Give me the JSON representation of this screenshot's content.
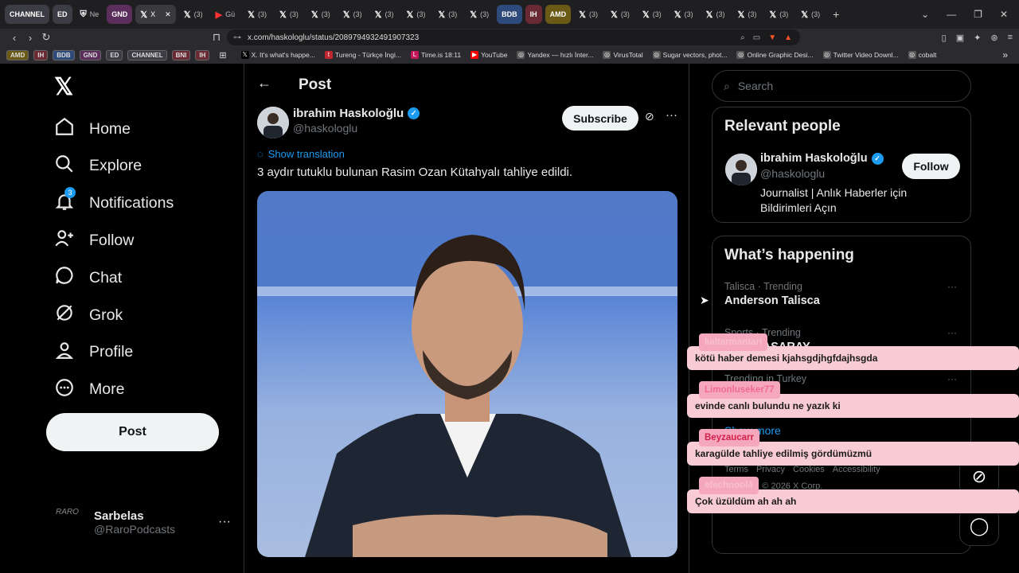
{
  "browser": {
    "tabs": [
      {
        "label": "CHANNEL",
        "group": true,
        "color": "#3c3c44"
      },
      {
        "label": "ED",
        "group": true,
        "color": "#3c3c44"
      },
      {
        "label": "Ne",
        "icon": "shield-icon"
      },
      {
        "label": "GND",
        "group": true,
        "color": "#5b2e5b"
      },
      {
        "label": "X",
        "icon": "x-icon",
        "active": true
      },
      {
        "label": "(3)",
        "icon": "x-icon"
      },
      {
        "label": "Gü",
        "icon": "yt-icon"
      },
      {
        "label": "(3)",
        "icon": "x-icon"
      },
      {
        "label": "(3)",
        "icon": "x-icon"
      },
      {
        "label": "(3)",
        "icon": "x-icon"
      },
      {
        "label": "(3)",
        "icon": "x-icon"
      },
      {
        "label": "(3)",
        "icon": "x-icon"
      },
      {
        "label": "(3)",
        "icon": "x-icon"
      },
      {
        "label": "(3)",
        "icon": "x-icon"
      },
      {
        "label": "(3)",
        "icon": "x-icon"
      },
      {
        "label": "BDB",
        "group": true,
        "color": "#2e4a7a"
      },
      {
        "label": "IH",
        "group": true,
        "color": "#6a2a33"
      },
      {
        "label": "AMD",
        "group": true,
        "color": "#6a5a16"
      },
      {
        "label": "(3)",
        "icon": "x-icon"
      },
      {
        "label": "(3)",
        "icon": "x-icon"
      },
      {
        "label": "(3)",
        "icon": "x-icon"
      },
      {
        "label": "(3)",
        "icon": "x-icon"
      },
      {
        "label": "(3)",
        "icon": "x-icon"
      },
      {
        "label": "(3)",
        "icon": "x-icon"
      },
      {
        "label": "(3)",
        "icon": "x-icon"
      },
      {
        "label": "(3)",
        "icon": "x-icon"
      }
    ],
    "url": "x.com/haskologlu/status/2089794932491907323",
    "bookmarks_groups": [
      "AMD",
      "IH",
      "BDB",
      "GND",
      "ED",
      "CHANNEL",
      "BNI",
      "IH"
    ],
    "bookmarks": [
      {
        "label": "X. It's what's happe...",
        "icon": "x-icon"
      },
      {
        "label": "Tureng - Türkçe İngi...",
        "icon": "t-icon"
      },
      {
        "label": "Time.is 18:11",
        "icon": "clock-icon"
      },
      {
        "label": "YouTube",
        "icon": "youtube-icon"
      },
      {
        "label": "Yandex — hızlı İnter...",
        "icon": "globe-icon"
      },
      {
        "label": "VirusTotal",
        "icon": "globe-icon"
      },
      {
        "label": "Sugar vectors, phot...",
        "icon": "globe-icon"
      },
      {
        "label": "Online Graphic Desi...",
        "icon": "globe-icon"
      },
      {
        "label": "Twitter Video Downl...",
        "icon": "globe-icon"
      },
      {
        "label": "cobalt",
        "icon": "globe-icon"
      }
    ]
  },
  "sidebar": {
    "items": [
      {
        "label": "Home",
        "icon": "home-icon"
      },
      {
        "label": "Explore",
        "icon": "search-icon"
      },
      {
        "label": "Notifications",
        "icon": "bell-icon",
        "badge": "3"
      },
      {
        "label": "Follow",
        "icon": "add-user-icon"
      },
      {
        "label": "Chat",
        "icon": "chat-icon"
      },
      {
        "label": "Grok",
        "icon": "grok-icon"
      },
      {
        "label": "Profile",
        "icon": "profile-icon"
      },
      {
        "label": "More",
        "icon": "more-circle-icon"
      }
    ],
    "post_label": "Post",
    "account": {
      "name": "Sarbelas",
      "handle": "@RaroPodcasts",
      "avatar_text": "RARO"
    }
  },
  "main": {
    "header_title": "Post",
    "author": {
      "name": "ibrahim Haskoloğlu",
      "handle": "@haskologlu"
    },
    "subscribe_label": "Subscribe",
    "show_translation": "Show translation",
    "text": "3 aydır tutuklu bulunan Rasim Ozan Kütahyalı tahliye edildi."
  },
  "aside": {
    "search_placeholder": "Search",
    "relevant_title": "Relevant people",
    "person": {
      "name": "ibrahim Haskoloğlu",
      "handle": "@haskologlu",
      "bio": "Journalist | Anlık Haberler için Bildirimleri Açın"
    },
    "follow_label": "Follow",
    "happening_title": "What’s happening",
    "trends": [
      {
        "context": "Talisca · Trending",
        "title": "Anderson Talisca"
      },
      {
        "context": "Sports · Trending",
        "title": "GALATASARAY"
      },
      {
        "context": "Trending in Turkey",
        "title": ""
      }
    ],
    "show_more": "Show more",
    "footer": [
      "Terms",
      "Privacy",
      "Cookies",
      "Accessibility",
      "More ...",
      "© 2026 X Corp."
    ]
  },
  "overlay_chat": [
    {
      "user": "kaltarmantari",
      "message": "kötü haber demesi kjahsgdjhgfdajhsgda"
    },
    {
      "user": "Limonluseker77",
      "message": "evinde canlı bulundu ne yazık ki"
    },
    {
      "user": "Beyzaucarr",
      "message": "karagülde tahliye edilmiş gördümüzmü"
    },
    {
      "user": "efechnool4",
      "message": "Çok üzüldüm ah ah ah"
    }
  ],
  "colors": {
    "accent": "#1d9bf0",
    "overlay_bg": "#f9ccd5",
    "overlay_name": "#f26a94"
  }
}
